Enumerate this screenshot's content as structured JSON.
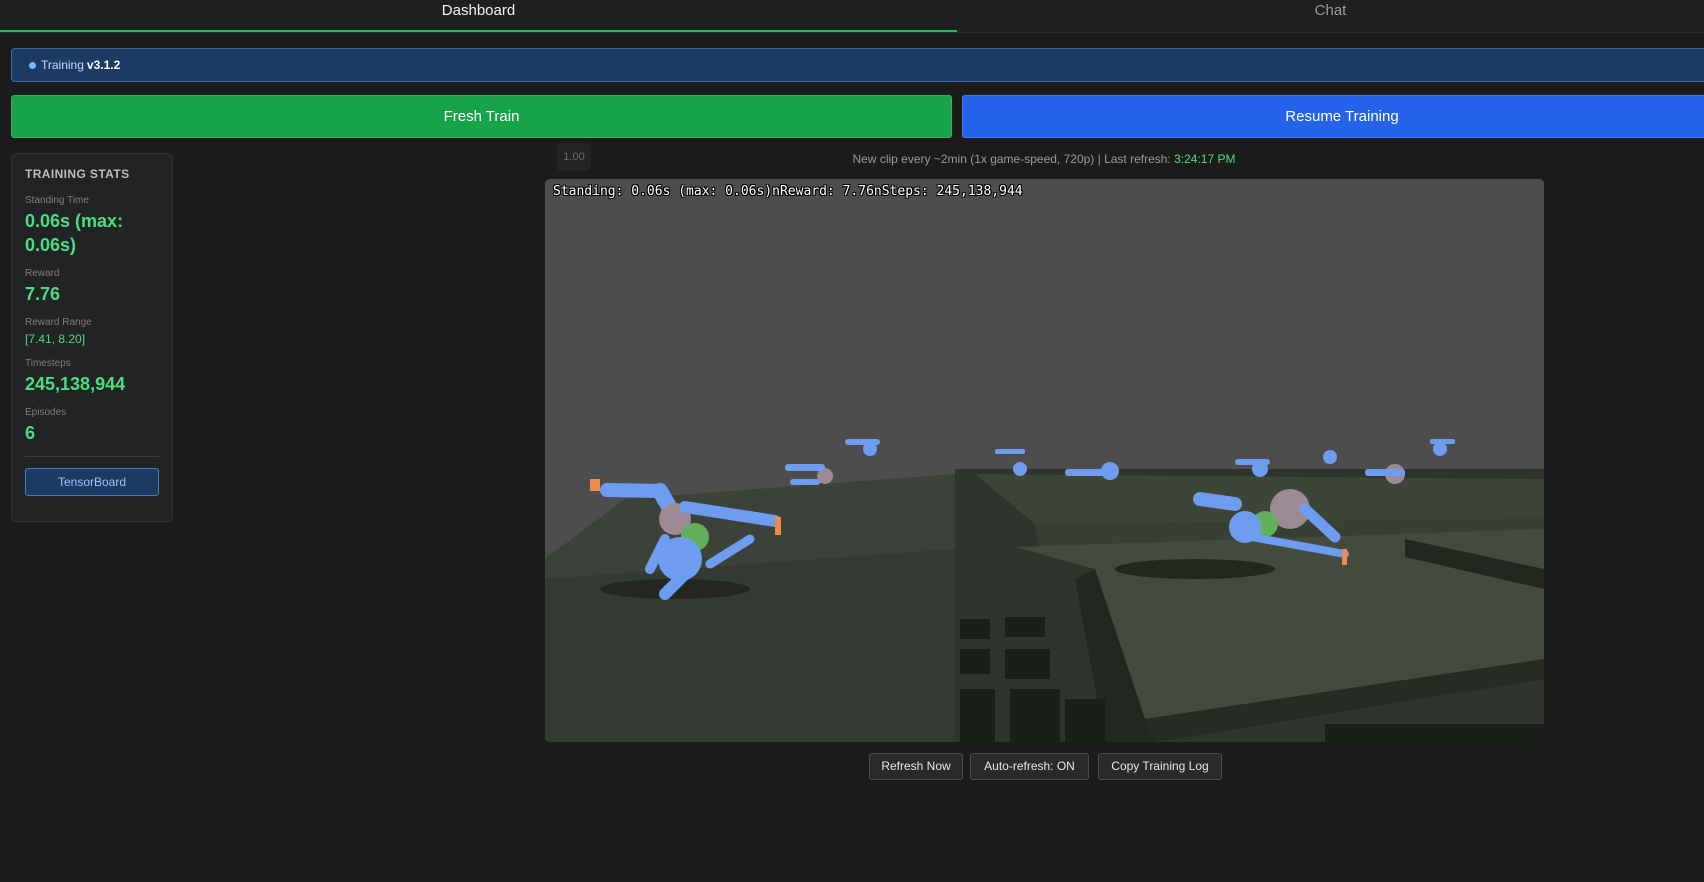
{
  "tabs": [
    {
      "label": "Dashboard",
      "active": true
    },
    {
      "label": "Chat",
      "active": false
    }
  ],
  "version_bar": {
    "prefix": "Training",
    "version": "v3.1.2"
  },
  "actions": {
    "fresh_train": "Fresh Train",
    "resume_training": "Resume Training"
  },
  "stats": {
    "title": "TRAINING STATS",
    "standing_time": {
      "label": "Standing Time",
      "value": "0.06s (max: 0.06s)"
    },
    "reward": {
      "label": "Reward",
      "value": "7.76"
    },
    "reward_range": {
      "label": "Reward Range",
      "value": "[7.41, 8.20]"
    },
    "timesteps": {
      "label": "Timesteps",
      "value": "245,138,944"
    },
    "episodes": {
      "label": "Episodes",
      "value": "6"
    },
    "tensorboard_label": "TensorBoard"
  },
  "speed_badge": "1.00",
  "clip_info": {
    "text": "New clip every ~2min (1x game-speed, 720p) | Last refresh:",
    "time": "3:24:17 PM"
  },
  "video": {
    "overlay_text": "Standing: 0.06s (max: 0.06s)nReward: 7.76nSteps: 245,138,944"
  },
  "controls": {
    "refresh": "Refresh Now",
    "auto_refresh": "Auto-refresh: ON",
    "copy_log": "Copy Training Log"
  },
  "colors": {
    "accent_green": "#16a34a",
    "accent_blue": "#2563eb",
    "stat_green": "#4ade80",
    "version_bg": "#1d3a63"
  },
  "icons": {
    "version_status": "status-dot-icon"
  }
}
